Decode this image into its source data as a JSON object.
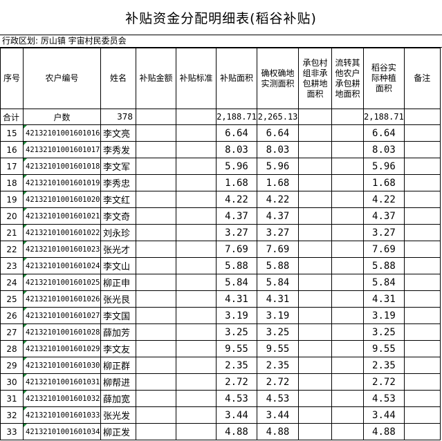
{
  "title": "补贴资金分配明细表(稻谷补贴)",
  "region": "行政区划: 厉山镇 宇宙村民委员会",
  "headers": {
    "seq": "序号",
    "farmer_id": "农户编号",
    "name": "姓名",
    "amount": "补贴金额",
    "standard": "补贴标准",
    "area": "补贴面积",
    "confirmed_area": "确权确地实测面积",
    "contract_area": "承包村组非承包耕地面积",
    "transfer_area": "流转其他农户承包耕地面积",
    "rice_area": "稻谷实际种植面积",
    "remark": "备注"
  },
  "summary": {
    "label": "合计",
    "households_label": "户数",
    "households": "378",
    "area": "2,188.71",
    "confirmed_area": "2,265.13",
    "rice_area": "2,188.71"
  },
  "rows": [
    {
      "seq": "15",
      "id": "421321010016010",
      "suffix": "16",
      "name": "李文亮",
      "area": "6.64",
      "confirmed": "6.64",
      "rice": "6.64"
    },
    {
      "seq": "16",
      "id": "421321010016010",
      "suffix": "17",
      "name": "李秀发",
      "area": "8.03",
      "confirmed": "8.03",
      "rice": "8.03"
    },
    {
      "seq": "17",
      "id": "421321010016010",
      "suffix": "18",
      "name": "李文军",
      "area": "5.96",
      "confirmed": "5.96",
      "rice": "5.96"
    },
    {
      "seq": "18",
      "id": "421321010016010",
      "suffix": "19",
      "name": "李秀忠",
      "area": "1.68",
      "confirmed": "1.68",
      "rice": "1.68"
    },
    {
      "seq": "19",
      "id": "421321010016010",
      "suffix": "20",
      "name": "李文红",
      "area": "4.22",
      "confirmed": "4.22",
      "rice": "4.22"
    },
    {
      "seq": "20",
      "id": "421321010016010",
      "suffix": "21",
      "name": "李文奇",
      "area": "4.37",
      "confirmed": "4.37",
      "rice": "4.37"
    },
    {
      "seq": "21",
      "id": "421321010016010",
      "suffix": "22",
      "name": "刘永珍",
      "area": "3.27",
      "confirmed": "3.27",
      "rice": "3.27"
    },
    {
      "seq": "22",
      "id": "421321010016010",
      "suffix": "23",
      "name": "张光才",
      "area": "7.69",
      "confirmed": "7.69",
      "rice": "7.69"
    },
    {
      "seq": "23",
      "id": "421321010016010",
      "suffix": "24",
      "name": "李文山",
      "area": "5.88",
      "confirmed": "5.88",
      "rice": "5.88"
    },
    {
      "seq": "24",
      "id": "421321010016010",
      "suffix": "25",
      "name": "柳正申",
      "area": "5.84",
      "confirmed": "5.84",
      "rice": "5.84"
    },
    {
      "seq": "25",
      "id": "421321010016010",
      "suffix": "26",
      "name": "张光艮",
      "area": "4.31",
      "confirmed": "4.31",
      "rice": "4.31"
    },
    {
      "seq": "26",
      "id": "421321010016010",
      "suffix": "27",
      "name": "李文国",
      "area": "3.19",
      "confirmed": "3.19",
      "rice": "3.19"
    },
    {
      "seq": "27",
      "id": "421321010016010",
      "suffix": "28",
      "name": "薛加芳",
      "area": "3.25",
      "confirmed": "3.25",
      "rice": "3.25"
    },
    {
      "seq": "28",
      "id": "421321010016010",
      "suffix": "29",
      "name": "李文友",
      "area": "9.55",
      "confirmed": "9.55",
      "rice": "9.55"
    },
    {
      "seq": "29",
      "id": "421321010016010",
      "suffix": "30",
      "name": "柳正群",
      "area": "2.35",
      "confirmed": "2.35",
      "rice": "2.35"
    },
    {
      "seq": "30",
      "id": "421321010016010",
      "suffix": "31",
      "name": "柳帮进",
      "area": "2.72",
      "confirmed": "2.72",
      "rice": "2.72"
    },
    {
      "seq": "31",
      "id": "421321010016010",
      "suffix": "32",
      "name": "薛加宽",
      "area": "4.53",
      "confirmed": "4.53",
      "rice": "4.53"
    },
    {
      "seq": "32",
      "id": "421321010016010",
      "suffix": "33",
      "name": "张光发",
      "area": "3.44",
      "confirmed": "3.44",
      "rice": "3.44"
    },
    {
      "seq": "33",
      "id": "421321010016010",
      "suffix": "34",
      "name": "柳正发",
      "area": "4.88",
      "confirmed": "4.88",
      "rice": "4.88"
    }
  ]
}
